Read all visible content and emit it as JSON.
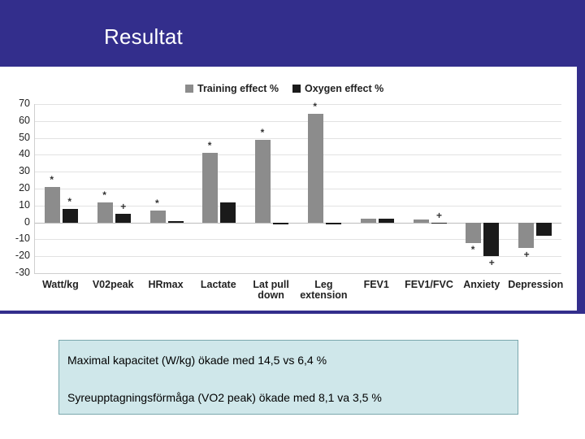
{
  "header": {
    "title": "Resultat",
    "band_color": "#332e8c"
  },
  "caption": {
    "line1": "Maximal kapacitet (W/kg) ökade med 14,5  vs 6,4 %",
    "line2": "Syreupptagningsförmåga (VO2 peak) ökade med 8,1 va 3,5 %",
    "background": "#cfe7ea",
    "border": "#7aa7ad"
  },
  "chart_data": {
    "type": "bar",
    "title": "",
    "xlabel": "",
    "ylabel": "",
    "ylim": [
      -30,
      70
    ],
    "yticks": [
      70,
      60,
      50,
      40,
      30,
      20,
      10,
      0,
      -10,
      -20,
      -30
    ],
    "ytick_labels": [
      "70",
      "60",
      "50",
      "40",
      "30",
      "20",
      "10",
      "0",
      "-10",
      "-20",
      "-30"
    ],
    "grid": true,
    "legend_position": "top-center",
    "categories": [
      "Watt/kg",
      "V02peak",
      "HRmax",
      "Lactate",
      "Lat pull down",
      "Leg extension",
      "FEV1",
      "FEV1/FVC",
      "Anxiety",
      "Depression"
    ],
    "series": [
      {
        "name": "Training effect %",
        "color": "#8c8c8c",
        "values": [
          21,
          12,
          7,
          41,
          49,
          64,
          2,
          1.5,
          -12,
          -15
        ]
      },
      {
        "name": "Oxygen effect %",
        "color": "#1a1a1a",
        "values": [
          8,
          5,
          1,
          12,
          -1,
          -1,
          2,
          0,
          -20,
          -8
        ]
      }
    ],
    "annotations": [
      {
        "text": "*",
        "category": "Watt/kg",
        "series": "Training effect %"
      },
      {
        "text": "*",
        "category": "Watt/kg",
        "series": "Oxygen effect %"
      },
      {
        "text": "*",
        "category": "V02peak",
        "series": "Training effect %"
      },
      {
        "text": "+",
        "category": "V02peak",
        "series": "Oxygen effect %"
      },
      {
        "text": "*",
        "category": "HRmax",
        "series": "Training effect %"
      },
      {
        "text": "*",
        "category": "Lactate",
        "series": "Training effect %"
      },
      {
        "text": "*",
        "category": "Lat pull down",
        "series": "Training effect %"
      },
      {
        "text": "*",
        "category": "Leg extension",
        "series": "Training effect %"
      },
      {
        "text": "+",
        "category": "FEV1/FVC",
        "series": "Oxygen effect %"
      },
      {
        "text": "*",
        "category": "Anxiety",
        "series": "Training effect %"
      },
      {
        "text": "+",
        "category": "Anxiety",
        "series": "Oxygen effect %"
      },
      {
        "text": "+",
        "category": "Depression",
        "series": "Training effect %"
      }
    ]
  }
}
